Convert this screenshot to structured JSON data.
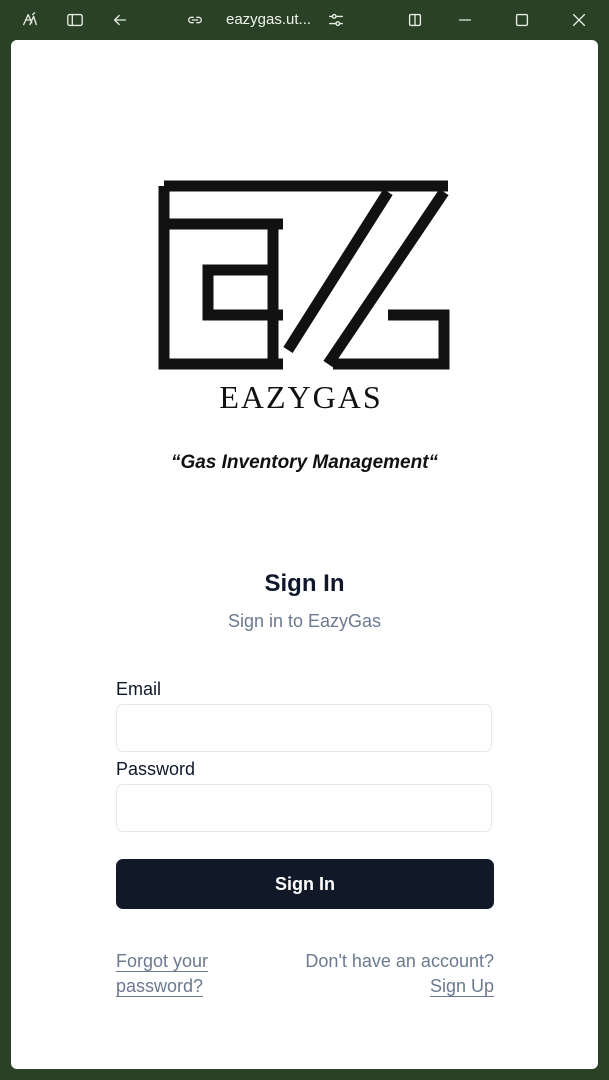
{
  "browser": {
    "url": "eazygas.ut...",
    "icons": [
      "app-icon",
      "sidebar-icon",
      "back-icon",
      "link-icon",
      "site-settings-icon",
      "split-view-icon",
      "minimize-icon",
      "maximize-icon",
      "close-icon"
    ]
  },
  "logo": {
    "wordmark": "EAZYGAS"
  },
  "tagline": "“Gas Inventory Management“",
  "form": {
    "title": "Sign In",
    "subtitle": "Sign in to EazyGas",
    "email_label": "Email",
    "email_value": "",
    "email_placeholder": "",
    "password_label": "Password",
    "password_value": "",
    "password_placeholder": "",
    "submit_label": "Sign In"
  },
  "links": {
    "forgot_line1": "Forgot your",
    "forgot_line2": "password?",
    "no_account": "Don't have an account?",
    "signup": "Sign Up"
  },
  "colors": {
    "frame": "#2b4126",
    "button": "#111827",
    "muted_text": "#6b7a90"
  }
}
